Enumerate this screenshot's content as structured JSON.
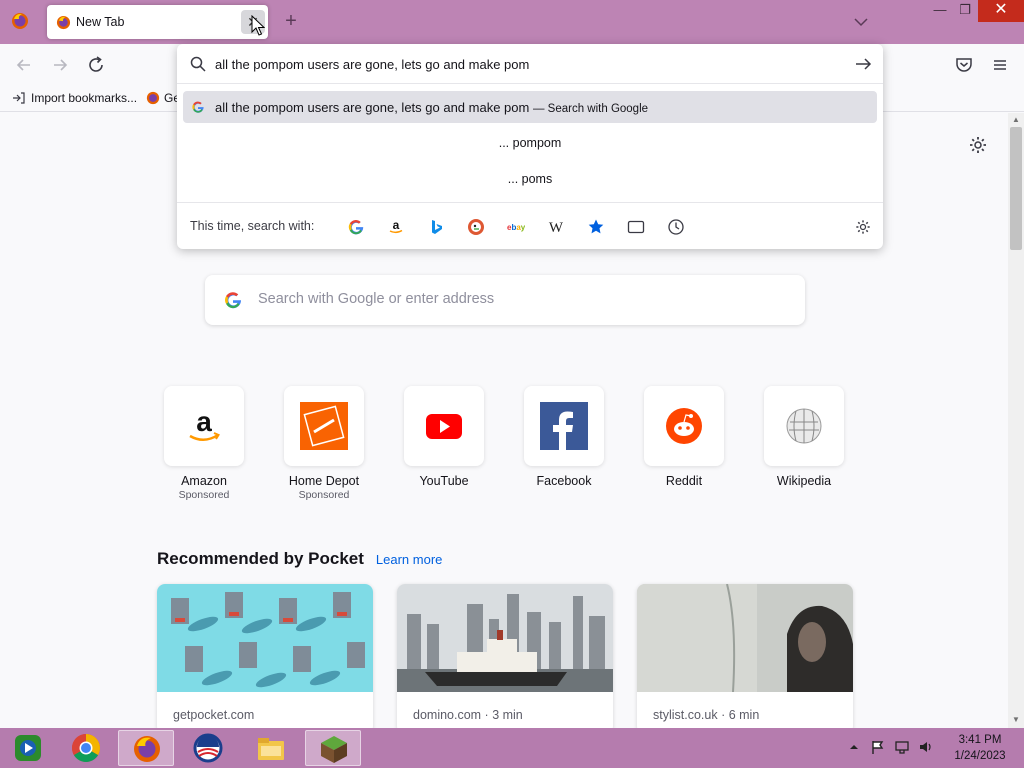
{
  "colors": {
    "tabstrip": "#bd84b4",
    "taskbar": "#b57cae",
    "accent": "#0060df",
    "close_red": "#c42b1c"
  },
  "tabs": [
    {
      "title": "New Tab",
      "close": "✕"
    }
  ],
  "window": {
    "minimize": "—",
    "maximize": "❐",
    "close": "✕"
  },
  "bookmarks": {
    "import_label": "Import bookmarks...",
    "second_label": "Ge"
  },
  "urlbar": {
    "value": "all the pompom users are gone, lets go and make pom",
    "suggestion_main": "all the pompom users are gone, lets go and make pom",
    "suggestion_hint": "— Search with Google",
    "tail_suggestions": [
      "... pompom",
      "... poms"
    ],
    "oneoff_label": "This time, search with:",
    "engines": [
      "google-icon",
      "amazon-icon",
      "bing-icon",
      "duckduckgo-icon",
      "ebay-icon",
      "wikipedia-icon",
      "bookmarks-star-icon",
      "tabs-icon",
      "history-icon"
    ]
  },
  "newtab": {
    "search_placeholder": "Search with Google or enter address",
    "topsites": [
      {
        "name": "Amazon",
        "sponsored": "Sponsored"
      },
      {
        "name": "Home Depot",
        "sponsored": "Sponsored"
      },
      {
        "name": "YouTube",
        "sponsored": ""
      },
      {
        "name": "Facebook",
        "sponsored": ""
      },
      {
        "name": "Reddit",
        "sponsored": ""
      },
      {
        "name": "Wikipedia",
        "sponsored": ""
      }
    ],
    "pocket": {
      "heading": "Recommended by Pocket",
      "learn_more": "Learn more",
      "cards": [
        {
          "source": "getpocket.com"
        },
        {
          "source": "domino.com · 3 min"
        },
        {
          "source": "stylist.co.uk · 6 min"
        }
      ]
    }
  },
  "taskbar": {
    "apps": [
      "media-center-icon",
      "chrome-icon",
      "firefox-icon",
      "obama-logo-icon",
      "file-explorer-icon",
      "minecraft-icon"
    ],
    "clock_time": "3:41 PM",
    "clock_date": "1/24/2023"
  }
}
